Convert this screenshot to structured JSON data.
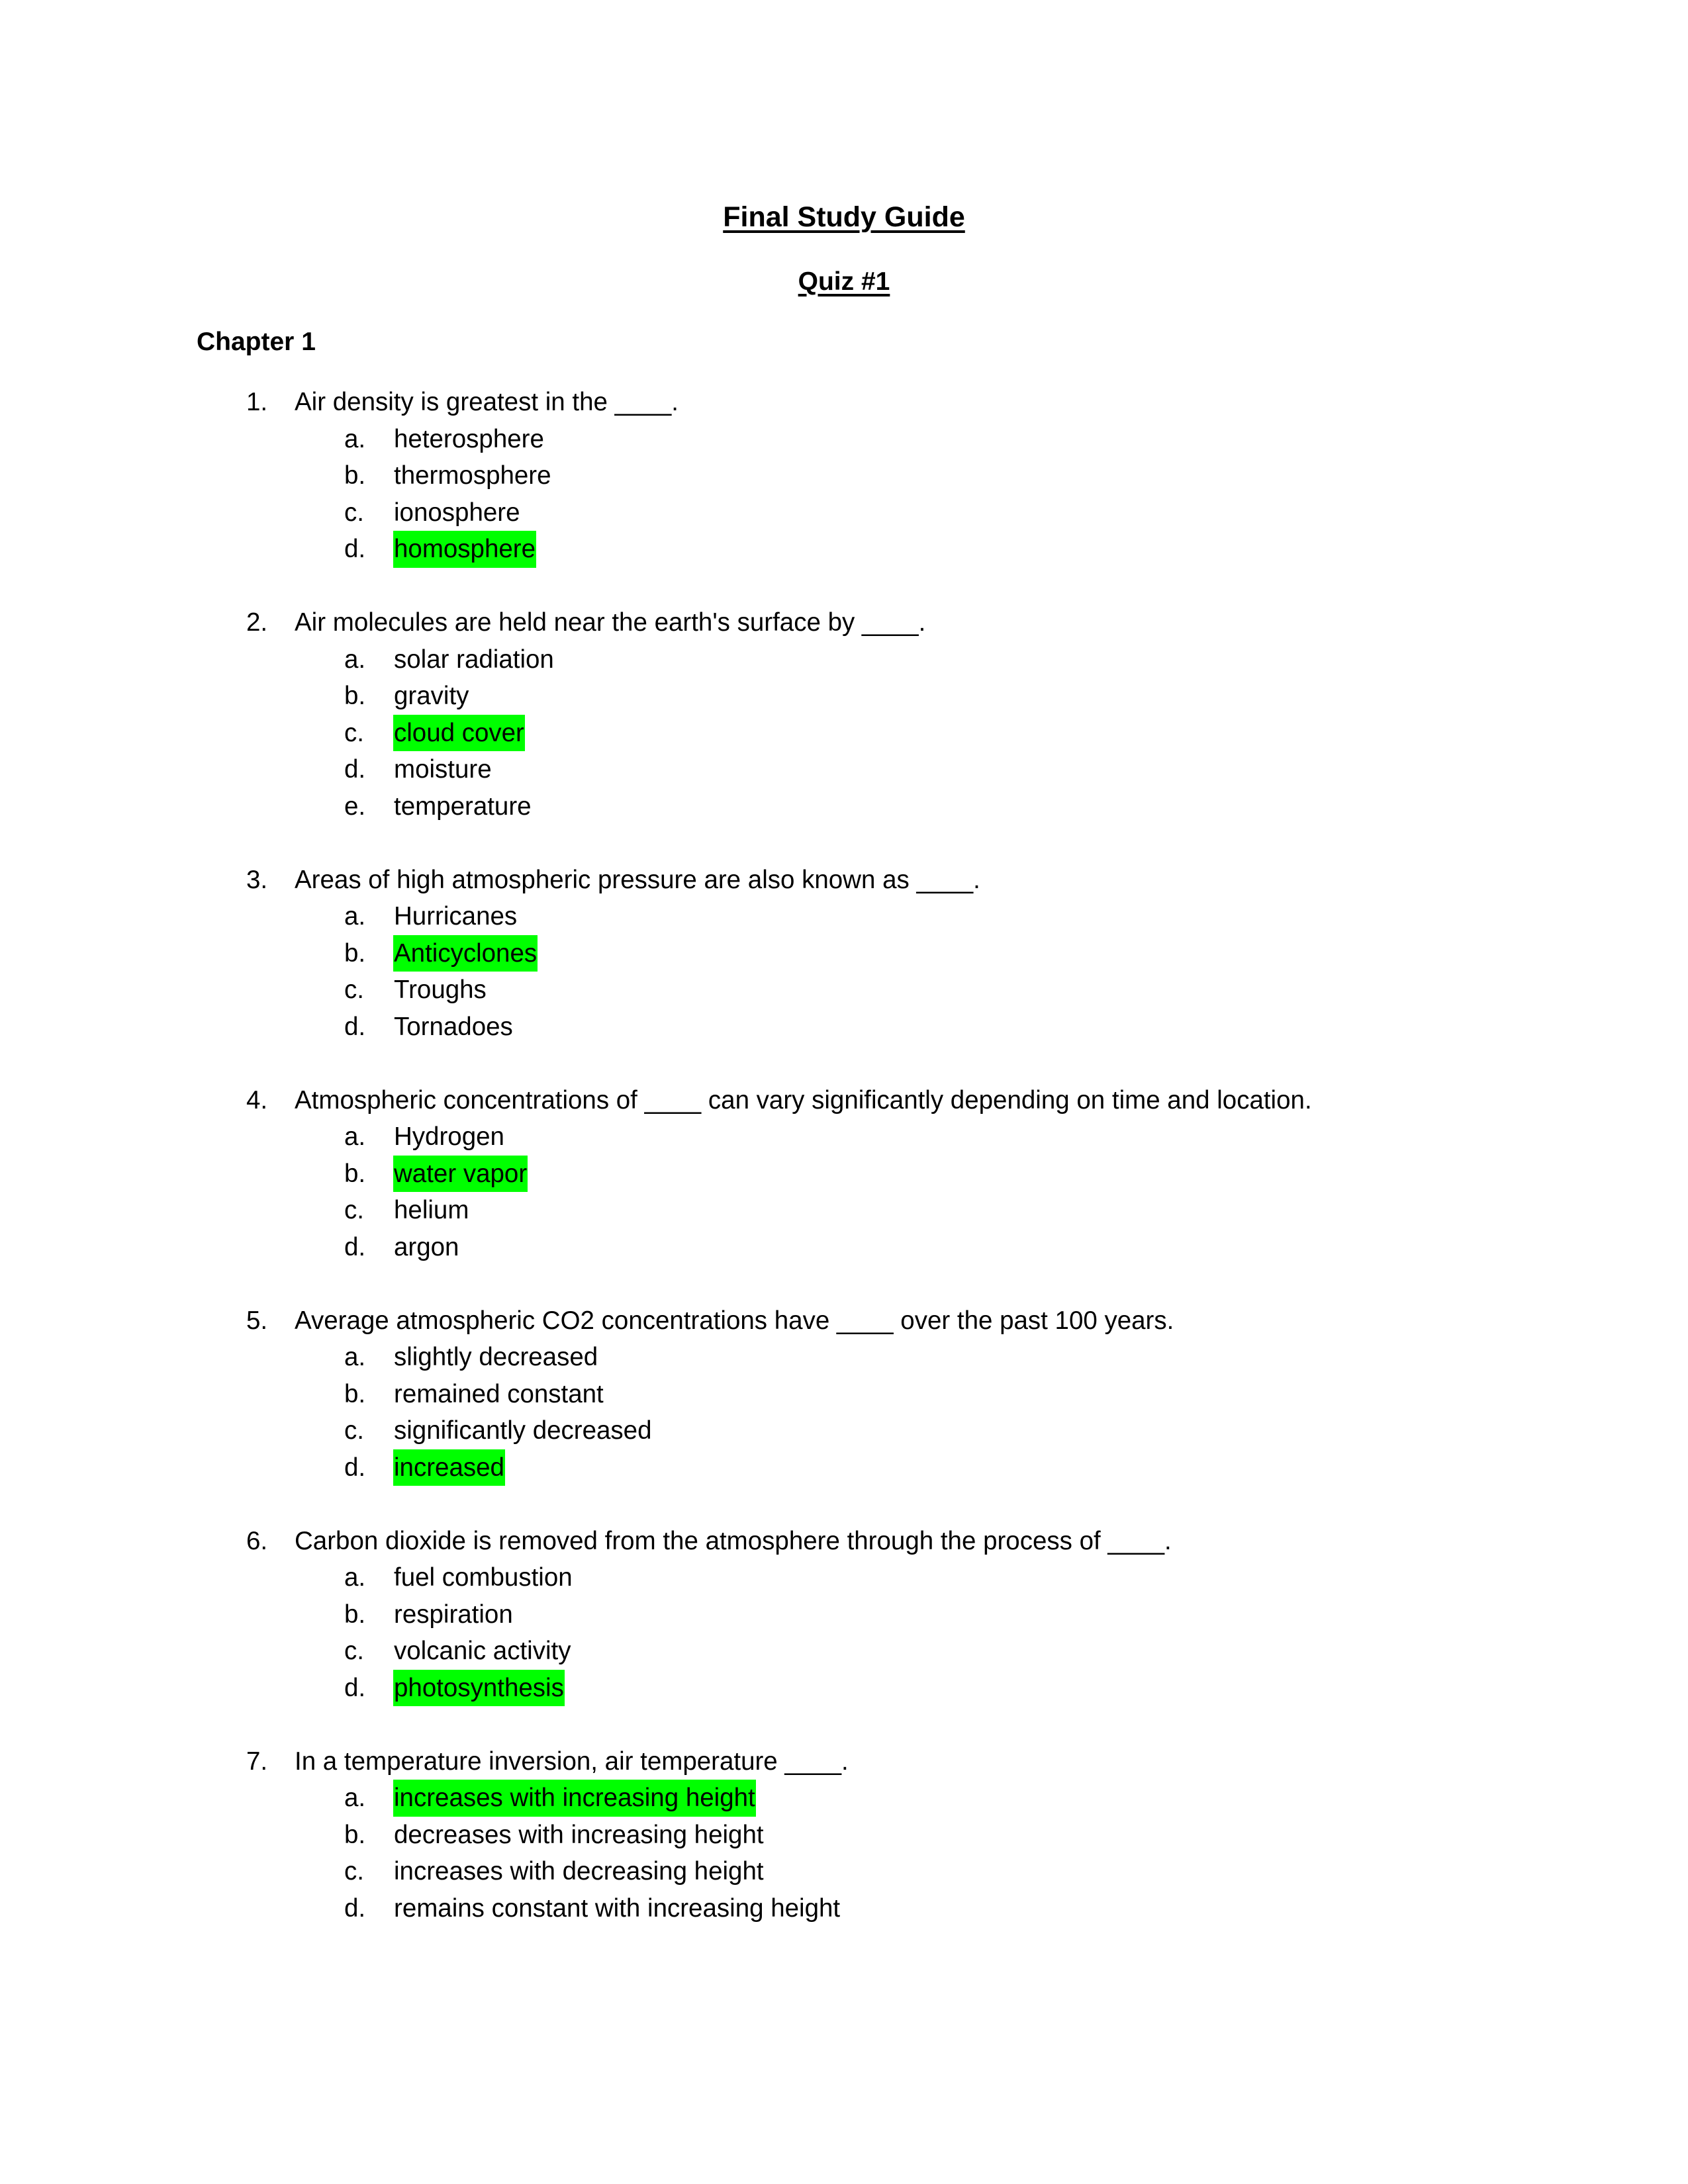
{
  "document": {
    "title": "Final Study Guide",
    "subtitle": "Quiz #1",
    "chapter": "Chapter 1",
    "highlight_color": "#00ff00"
  },
  "questions": [
    {
      "number": "1.",
      "text": "Air density is greatest in the ____.",
      "options": [
        {
          "letter": "a.",
          "text": "heterosphere",
          "highlighted": false
        },
        {
          "letter": "b.",
          "text": "thermosphere",
          "highlighted": false
        },
        {
          "letter": "c.",
          "text": "ionosphere",
          "highlighted": false
        },
        {
          "letter": "d.",
          "text": "homosphere",
          "highlighted": true
        }
      ]
    },
    {
      "number": "2.",
      "text": "Air molecules are held near the earth's surface by ____.",
      "options": [
        {
          "letter": "a.",
          "text": "solar radiation",
          "highlighted": false
        },
        {
          "letter": "b.",
          "text": "gravity",
          "highlighted": false
        },
        {
          "letter": "c.",
          "text": "cloud cover",
          "highlighted": true
        },
        {
          "letter": "d.",
          "text": "moisture",
          "highlighted": false
        },
        {
          "letter": "e.",
          "text": "temperature",
          "highlighted": false
        }
      ]
    },
    {
      "number": "3.",
      "text": "Areas of high atmospheric pressure are also known as ____.",
      "options": [
        {
          "letter": "a.",
          "text": "Hurricanes",
          "highlighted": false
        },
        {
          "letter": "b.",
          "text": "Anticyclones",
          "highlighted": true
        },
        {
          "letter": "c.",
          "text": "Troughs",
          "highlighted": false
        },
        {
          "letter": "d.",
          "text": "Tornadoes",
          "highlighted": false
        }
      ]
    },
    {
      "number": "4.",
      "text": "Atmospheric concentrations of ____ can vary significantly depending on time and location.",
      "options": [
        {
          "letter": "a.",
          "text": "Hydrogen",
          "highlighted": false
        },
        {
          "letter": "b.",
          "text": "water vapor",
          "highlighted": true
        },
        {
          "letter": "c.",
          "text": "helium",
          "highlighted": false
        },
        {
          "letter": "d.",
          "text": "argon",
          "highlighted": false
        }
      ]
    },
    {
      "number": "5.",
      "text": "Average atmospheric CO2 concentrations have ____ over the past 100 years.",
      "options": [
        {
          "letter": "a.",
          "text": "slightly decreased",
          "highlighted": false
        },
        {
          "letter": "b.",
          "text": "remained constant",
          "highlighted": false
        },
        {
          "letter": "c.",
          "text": "significantly decreased",
          "highlighted": false
        },
        {
          "letter": "d.",
          "text": "increased",
          "highlighted": true
        }
      ]
    },
    {
      "number": "6.",
      "text": "Carbon dioxide is removed from the atmosphere through the process of ____.",
      "options": [
        {
          "letter": "a.",
          "text": "fuel combustion",
          "highlighted": false
        },
        {
          "letter": "b.",
          "text": "respiration",
          "highlighted": false
        },
        {
          "letter": "c.",
          "text": "volcanic activity",
          "highlighted": false
        },
        {
          "letter": "d.",
          "text": "photosynthesis",
          "highlighted": true
        }
      ]
    },
    {
      "number": "7.",
      "text": "In a temperature inversion, air temperature ____.",
      "options": [
        {
          "letter": "a.",
          "text": "increases with increasing height",
          "highlighted": true
        },
        {
          "letter": "b.",
          "text": "decreases with increasing height",
          "highlighted": false
        },
        {
          "letter": "c.",
          "text": "increases with decreasing height",
          "highlighted": false
        },
        {
          "letter": "d.",
          "text": "remains constant with increasing height",
          "highlighted": false
        }
      ]
    }
  ]
}
